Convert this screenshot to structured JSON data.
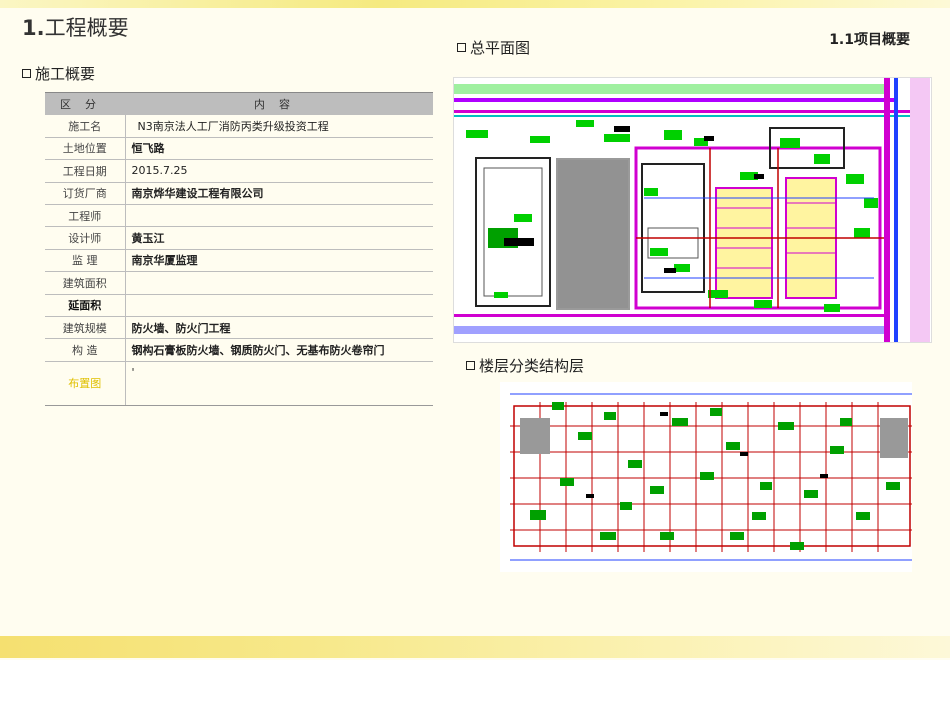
{
  "page_title": {
    "number": "1.",
    "text": "工程概要"
  },
  "subtitle": "1.1项目概要",
  "sections": {
    "construction_overview": "施工概要",
    "site_plan": "总平面图",
    "floor_structure": "楼层分类结构层"
  },
  "table": {
    "header": {
      "col1": "区分",
      "col2": "内容"
    },
    "rows": [
      {
        "label": "施工名",
        "value": "N3南京法人工厂消防丙类升级投资工程"
      },
      {
        "label": "土地位置",
        "value": "恒飞路"
      },
      {
        "label": "工程日期",
        "value": "2015.7.25"
      },
      {
        "label": "订货厂商",
        "value": "南京烨华建设工程有限公司"
      },
      {
        "label": "工程师",
        "value": ""
      },
      {
        "label": "设计师",
        "value": "黄玉江"
      },
      {
        "label": "监  理",
        "value": "南京华厦监理"
      },
      {
        "label": "建筑面积",
        "value": ""
      },
      {
        "label": "延面积",
        "value": ""
      },
      {
        "label": "建筑规模",
        "value": "防火墙、防火门工程"
      },
      {
        "label": "构  造",
        "value": "钢构石膏板防火墙、钢质防火门、无基布防火卷帘门"
      },
      {
        "label": "布置图",
        "value": "'"
      }
    ]
  },
  "colors": {
    "band": "#f5e070",
    "table_header": "#bdbdbd",
    "cad_green": "#00c000",
    "cad_magenta": "#d000d0",
    "cad_red": "#c00000",
    "cad_blue": "#2040ff",
    "cad_yellow": "#fff4a0"
  }
}
